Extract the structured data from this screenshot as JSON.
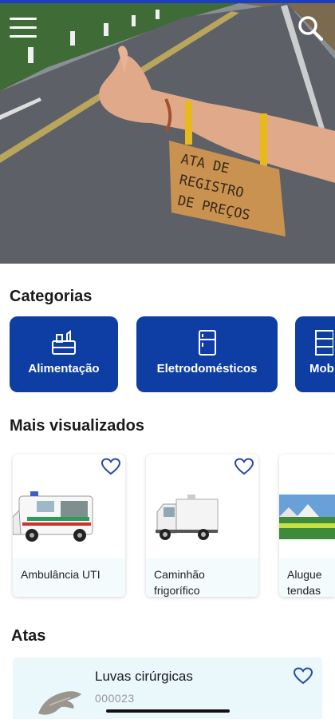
{
  "hero": {
    "sign_text": [
      "ATA DE",
      "REGISTRO",
      "DE PREÇOS"
    ],
    "menu_icon": "hamburger-menu-icon",
    "search_icon": "search-icon"
  },
  "categories": {
    "title": "Categorias",
    "items": [
      {
        "label": "Alimentação",
        "icon": "food-basket-icon"
      },
      {
        "label": "Eletrodomésticos",
        "icon": "refrigerator-icon"
      },
      {
        "label": "Mob",
        "icon": "furniture-icon"
      }
    ]
  },
  "most_viewed": {
    "title": "Mais visualizados",
    "items": [
      {
        "label": "Ambulância UTI",
        "icon": "ambulance-image"
      },
      {
        "label": "Caminhão frigorífico",
        "icon": "truck-image"
      },
      {
        "label": "Alugue tendas",
        "icon": "tent-image"
      }
    ]
  },
  "atas": {
    "title": "Atas",
    "items": [
      {
        "title": "Luvas cirúrgicas",
        "code": "000023"
      }
    ]
  },
  "colors": {
    "accent": "#0e3ea3",
    "card_bottom": "#f3fbfd",
    "heart": "#2848a8"
  }
}
